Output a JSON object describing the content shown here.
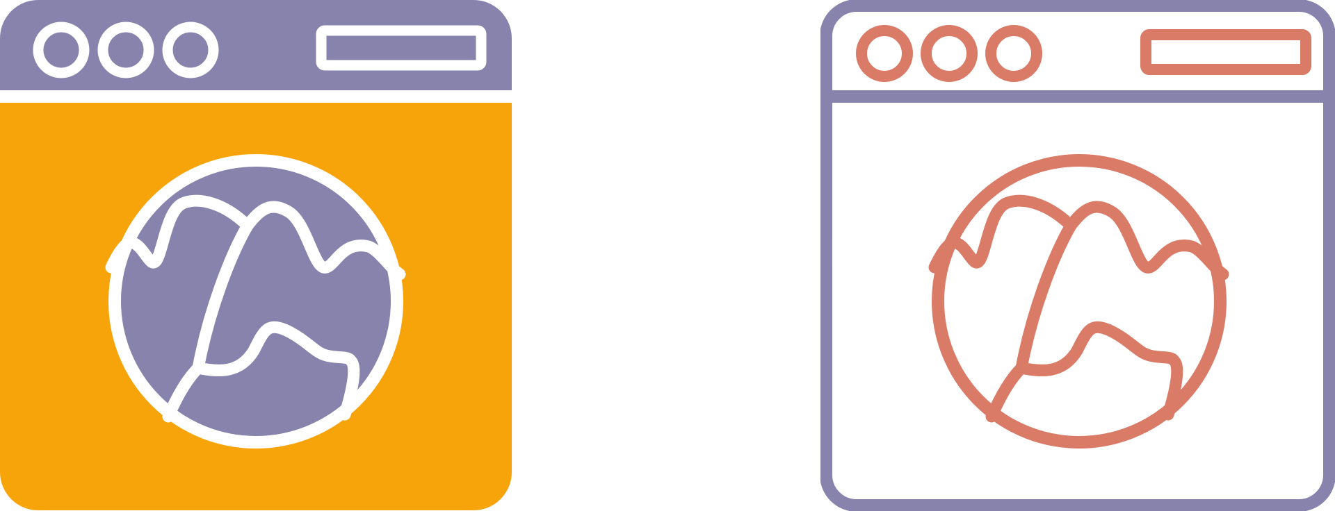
{
  "colors": {
    "purple": "#8783AC",
    "orange": "#F7A30A",
    "coral": "#D97B66",
    "white": "#FFFFFF"
  },
  "icons": [
    {
      "name": "browser-globe-icon",
      "style": "glyph-filled",
      "window_dots": 3
    },
    {
      "name": "browser-globe-icon",
      "style": "line-outline",
      "window_dots": 3
    }
  ]
}
